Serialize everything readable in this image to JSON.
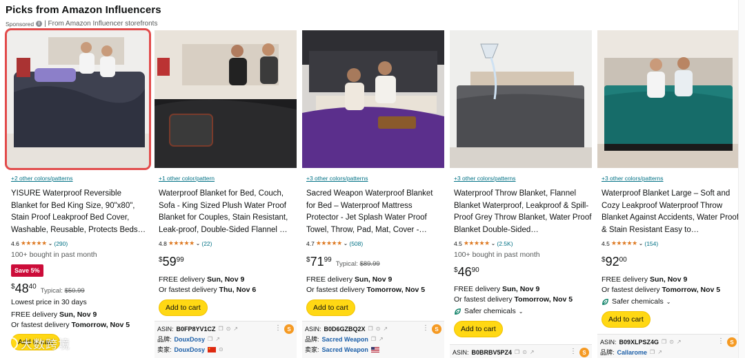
{
  "header": {
    "title": "Picks from Amazon Influencers",
    "sponsored": "Sponsored",
    "storefronts": "| From Amazon Influencer storefronts"
  },
  "cards": [
    {
      "colors": "+2 other colors/patterns",
      "title": "YISURE Waterproof Reversible Blanket for Bed King Size, 90\"x80\", Stain Proof Leakproof Bed Cover, Washable, Reusable, Protects Beds…",
      "rating": "4.6",
      "reviews": "(290)",
      "bought": "100+ bought in past month",
      "badge": "Save 5%",
      "price_whole": "48",
      "price_frac": "40",
      "typical_label": "Typical:",
      "typical_price": "$50.99",
      "lowest": "Lowest price in 30 days",
      "delivery": "FREE delivery",
      "delivery_date": "Sun, Nov 9",
      "fastest": "Or fastest delivery",
      "fastest_date": "Tomorrow, Nov 5",
      "cart": "Add to cart"
    },
    {
      "colors": "+1 other color/pattern",
      "title": "Waterproof Blanket for Bed, Couch, Sofa - King Sized Plush Water Proof Blanket for Couples, Stain Resistant, Leak-proof, Double-Sided Flannel …",
      "rating": "4.8",
      "reviews": "(22)",
      "price_whole": "59",
      "price_frac": "99",
      "delivery": "FREE delivery",
      "delivery_date": "Sun, Nov 9",
      "fastest": "Or fastest delivery",
      "fastest_date": "Thu, Nov 6",
      "cart": "Add to cart",
      "asin_label": "ASIN:",
      "asin": "B0FP8YV1CZ",
      "brand_label": "品牌:",
      "brand": "DouxDosy",
      "seller_label": "卖家:",
      "seller": "DouxDosy"
    },
    {
      "colors": "+3 other colors/patterns",
      "title": "Sacred Weapon Waterproof Blanket for Bed – Waterproof Mattress Protector - Jet Splash Water Proof Towel, Throw, Pad, Mat, Cover -…",
      "rating": "4.7",
      "reviews": "(508)",
      "price_whole": "71",
      "price_frac": "99",
      "typical_label": "Typical:",
      "typical_price": "$89.99",
      "delivery": "FREE delivery",
      "delivery_date": "Sun, Nov 9",
      "fastest": "Or fastest delivery",
      "fastest_date": "Tomorrow, Nov 5",
      "cart": "Add to cart",
      "asin_label": "ASIN:",
      "asin": "B0D6GZBQ2X",
      "brand_label": "品牌:",
      "brand": "Sacred Weapon",
      "seller_label": "卖家:",
      "seller": "Sacred Weapon"
    },
    {
      "colors": "+3 other colors/patterns",
      "title": "Waterproof Throw Blanket, Flannel Blanket Waterproof, Leakproof & Spill-Proof Grey Throw Blanket, Water Proof Blanket Double-Sided…",
      "rating": "4.5",
      "reviews": "(2.5K)",
      "bought": "100+ bought in past month",
      "price_whole": "46",
      "price_frac": "90",
      "delivery": "FREE delivery",
      "delivery_date": "Sun, Nov 9",
      "fastest": "Or fastest delivery",
      "fastest_date": "Tomorrow, Nov 5",
      "safer": "Safer chemicals",
      "cart": "Add to cart",
      "asin_label": "ASIN:",
      "asin": "B0BRBV5PZ4"
    },
    {
      "colors": "+3 other colors/patterns",
      "title": "Waterproof Blanket Large – Soft and Cozy Leakproof Waterproof Throw Blanket Against Accidents, Water Proof & Stain Resistant Easy to…",
      "rating": "4.5",
      "reviews": "(154)",
      "price_whole": "92",
      "price_frac": "00",
      "delivery": "FREE delivery",
      "delivery_date": "Sun, Nov 9",
      "fastest": "Or fastest delivery",
      "fastest_date": "Tomorrow, Nov 5",
      "safer": "Safer chemicals",
      "cart": "Add to cart",
      "asin_label": "ASIN:",
      "asin": "B09XLPSZ4G",
      "brand_label": "品牌:",
      "brand": "Callarome"
    }
  ],
  "currency": "$",
  "stars": "★★★★★",
  "watermark": "大数跨境",
  "colors": {
    "link": "#007185",
    "star": "#de7921",
    "button": "#ffd814",
    "badge": "#cc0c39",
    "selection": "#e24a4a"
  }
}
